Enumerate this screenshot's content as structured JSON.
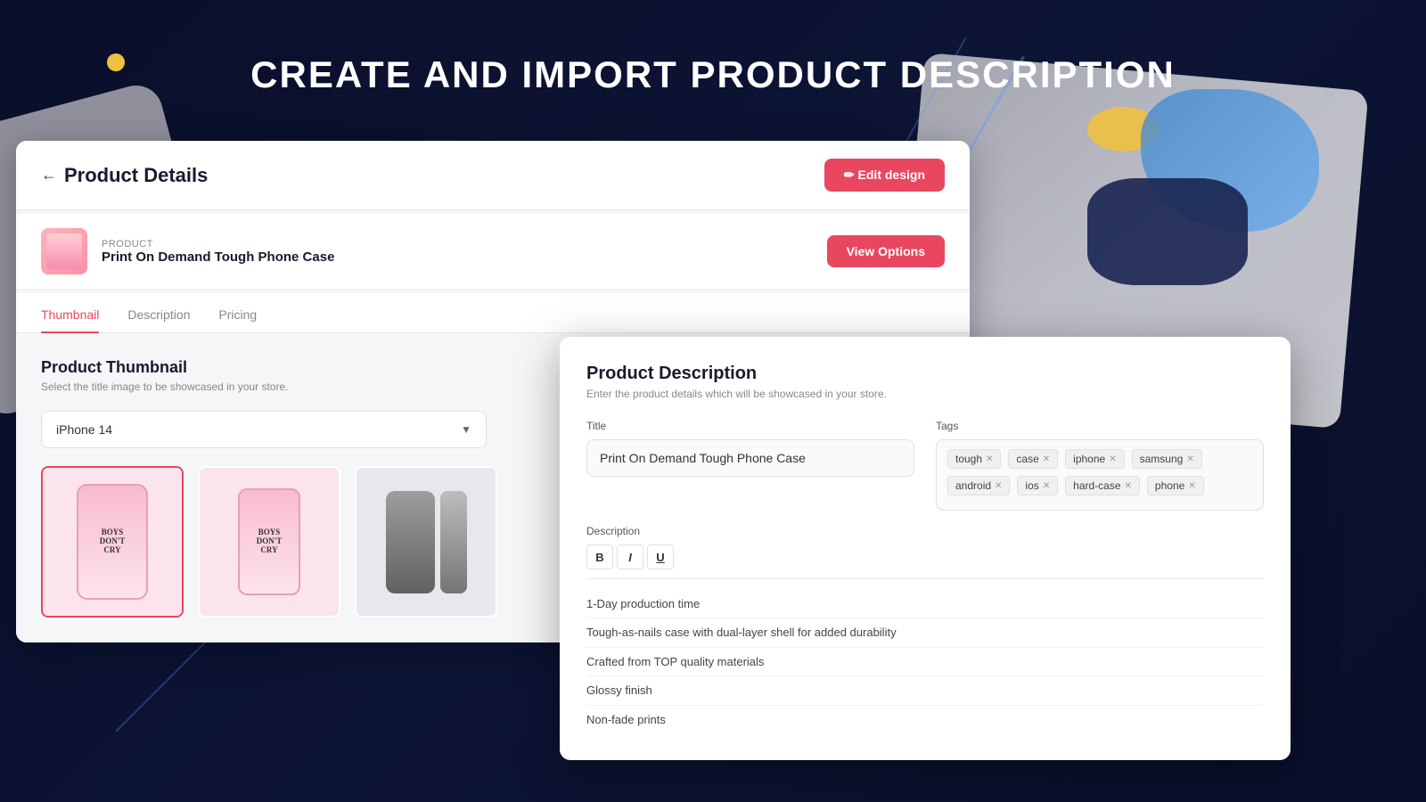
{
  "page": {
    "heading": "CREATE AND IMPORT PRODUCT DESCRIPTION"
  },
  "product_details": {
    "title": "Product Details",
    "back_label": "←",
    "edit_design_label": "✏ Edit design",
    "product_label": "Product",
    "product_name": "Print On Demand Tough Phone Case",
    "view_options_label": "View Options"
  },
  "tabs": [
    {
      "id": "thumbnail",
      "label": "Thumbnail",
      "active": true
    },
    {
      "id": "description",
      "label": "Description",
      "active": false
    },
    {
      "id": "pricing",
      "label": "Pricing",
      "active": false
    }
  ],
  "thumbnail_section": {
    "title": "Product Thumbnail",
    "subtitle": "Select the title image to be showcased in your store.",
    "dropdown_value": "iPhone 14",
    "images": [
      {
        "id": 1,
        "selected": true,
        "alt": "Phone case front pink"
      },
      {
        "id": 2,
        "selected": false,
        "alt": "Phone case front pink 2"
      },
      {
        "id": 3,
        "selected": false,
        "alt": "Phone case multi gray"
      }
    ]
  },
  "description_panel": {
    "title": "Product Description",
    "subtitle": "Enter the product details which will be showcased in your store.",
    "title_label": "Title",
    "title_value": "Print On Demand Tough Phone Case",
    "tags_label": "Tags",
    "tags": [
      {
        "id": 1,
        "label": "tough"
      },
      {
        "id": 2,
        "label": "case"
      },
      {
        "id": 3,
        "label": "iphone"
      },
      {
        "id": 4,
        "label": "samsung"
      },
      {
        "id": 5,
        "label": "android"
      },
      {
        "id": 6,
        "label": "ios"
      },
      {
        "id": 7,
        "label": "hard-case"
      },
      {
        "id": 8,
        "label": "phone"
      }
    ],
    "description_label": "Description",
    "toolbar": {
      "bold": "B",
      "italic": "I",
      "underline": "U"
    },
    "description_items": [
      "1-Day production time",
      "Tough-as-nails case with dual-layer shell for added durability",
      "Crafted from TOP quality materials",
      "Glossy finish",
      "Non-fade prints"
    ]
  }
}
